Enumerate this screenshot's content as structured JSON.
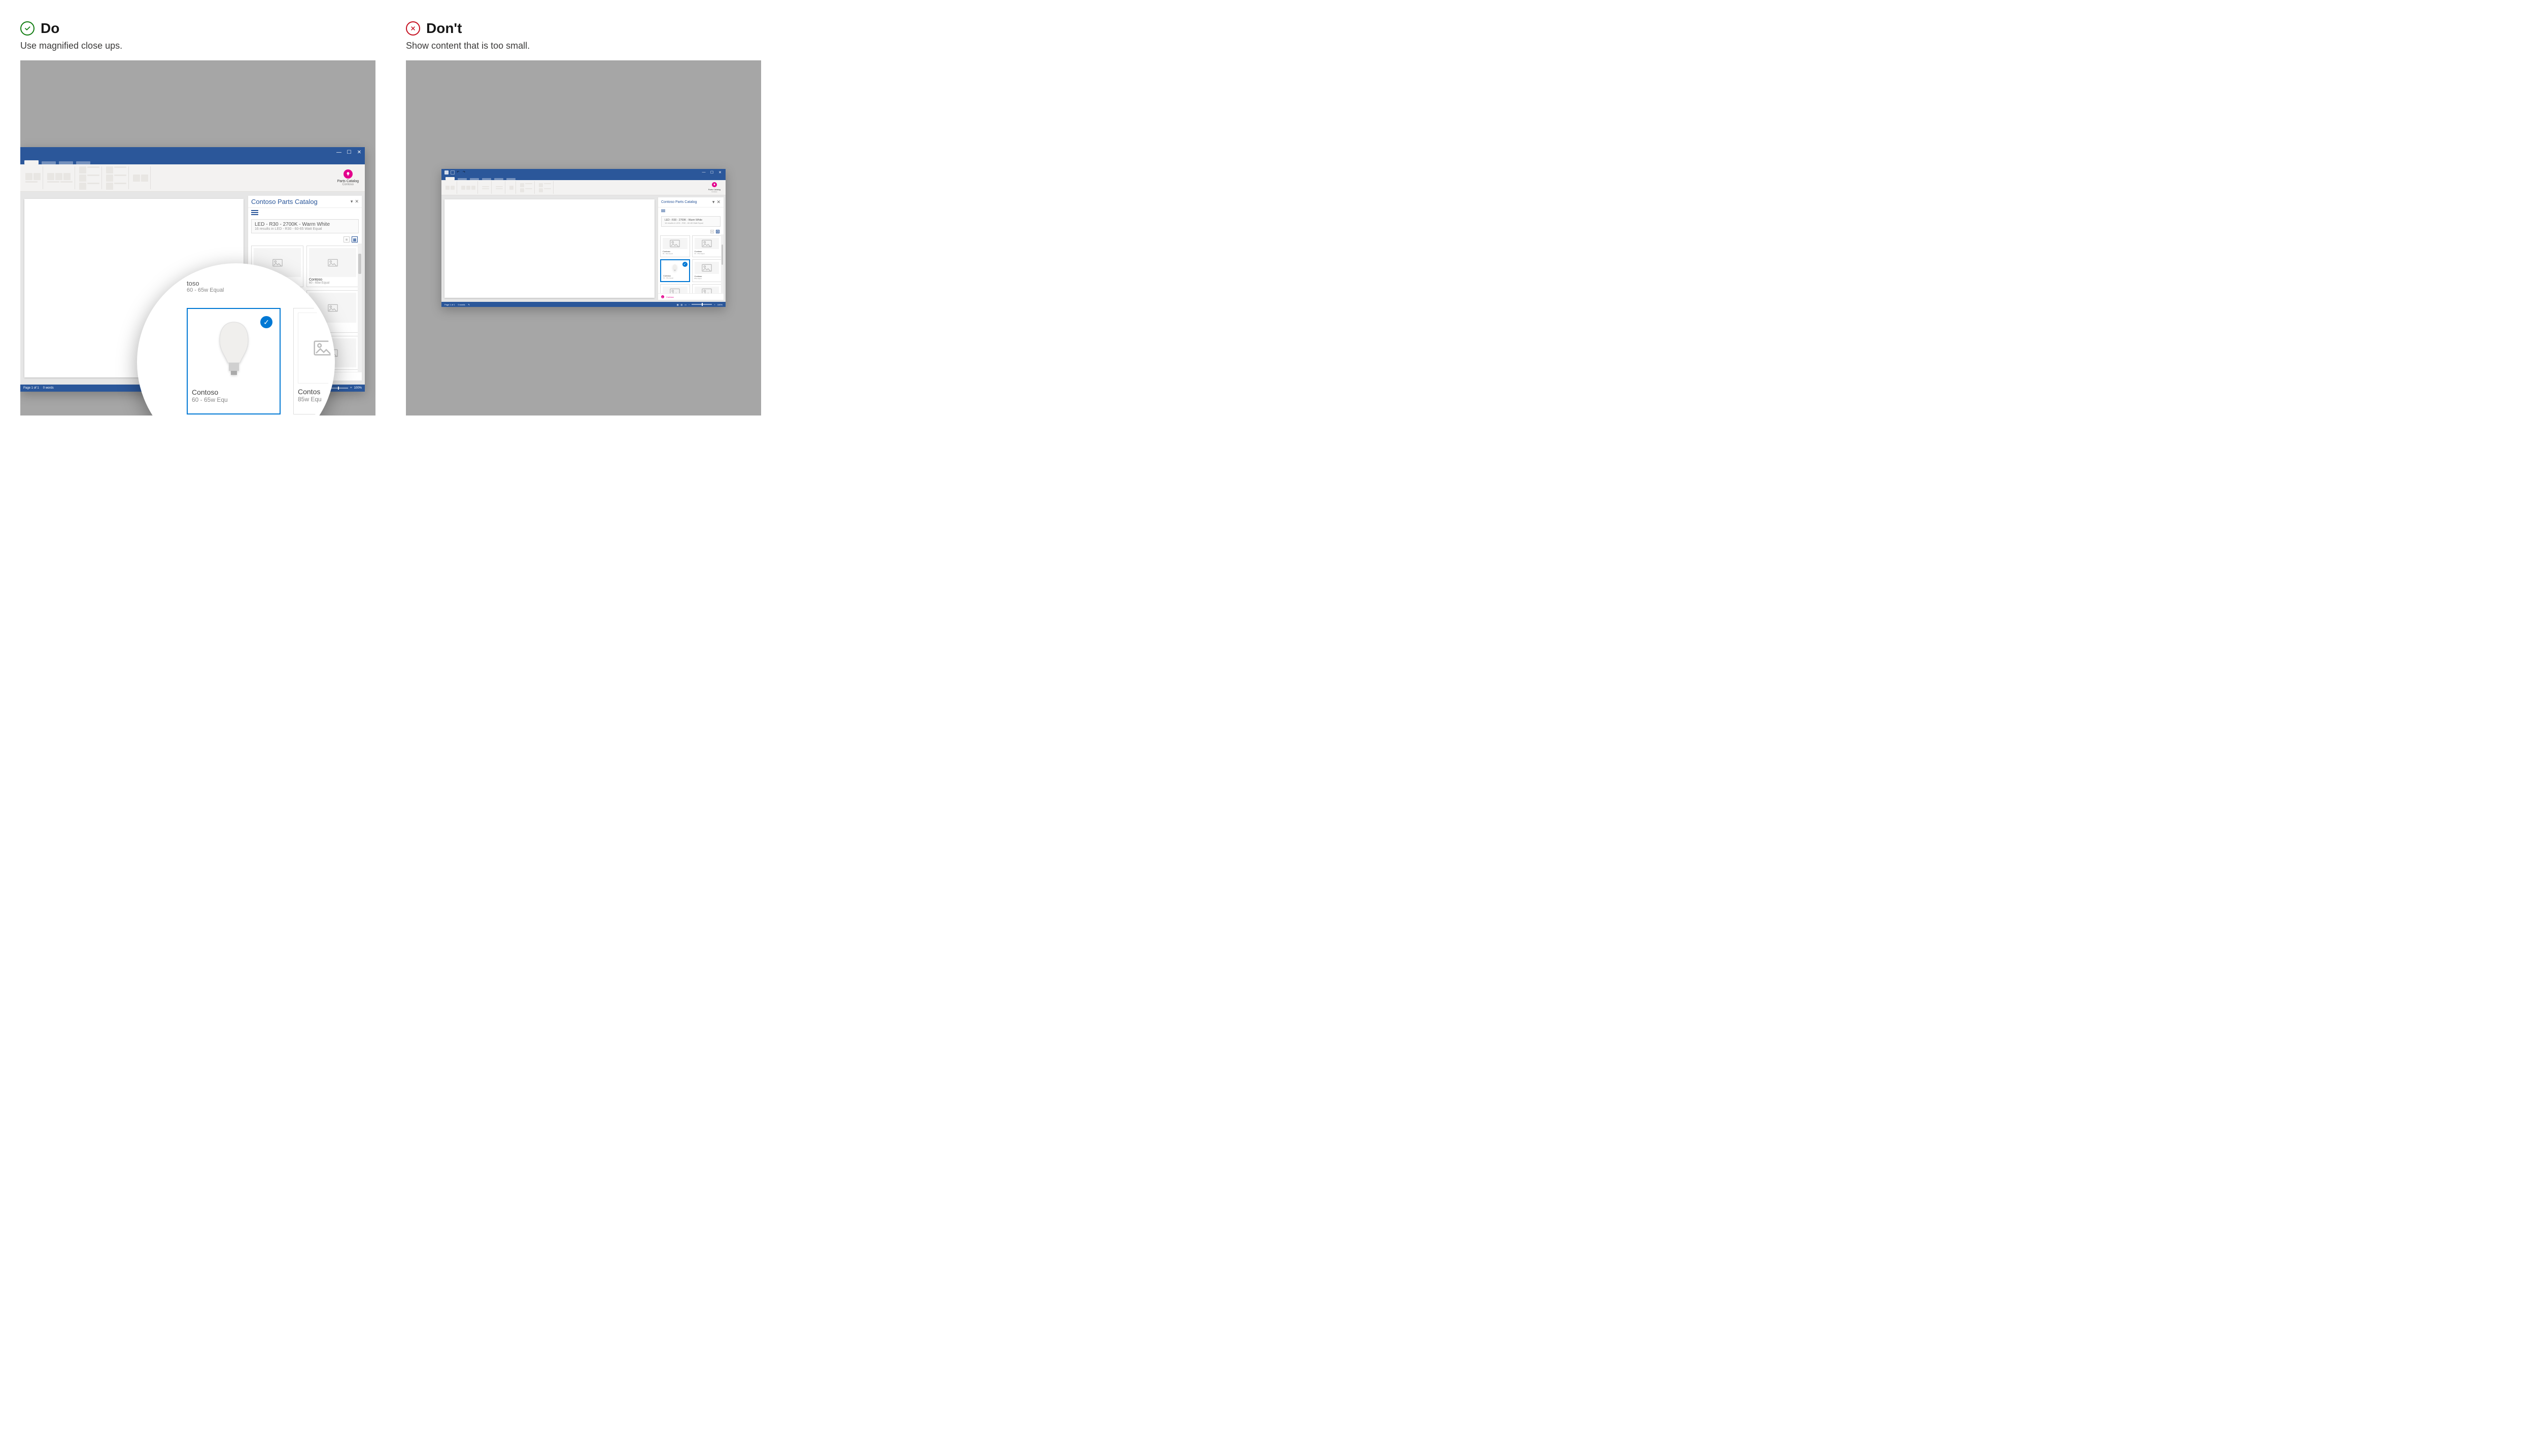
{
  "do": {
    "heading": "Do",
    "subtitle": "Use magnified close ups."
  },
  "dont": {
    "heading": "Don't",
    "subtitle": "Show content that is too small."
  },
  "addin": {
    "name": "Parts Catalog",
    "company": "Contoso"
  },
  "pane": {
    "title": "Contoso Parts Catalog",
    "search_title": "LED - R30 - 2700K - Warm White",
    "search_sub": "16 results in LED - R30 - 60-65 Watt Equal",
    "footer": "Contoso"
  },
  "cards": {
    "brand": "Contoso",
    "variant_a": "60 - 65w Equal",
    "variant_b": "85w Equal"
  },
  "status": {
    "page": "Page 1 of 1",
    "words": "0 words",
    "zoom": "100%"
  },
  "magnifier": {
    "top_name_suffix": "toso",
    "top_sub": "60 - 65w Equal",
    "sel_name": "Contoso",
    "sel_sub": "60 - 65w Equ",
    "right_name": "Contos",
    "right_sub": "85w Equ"
  }
}
